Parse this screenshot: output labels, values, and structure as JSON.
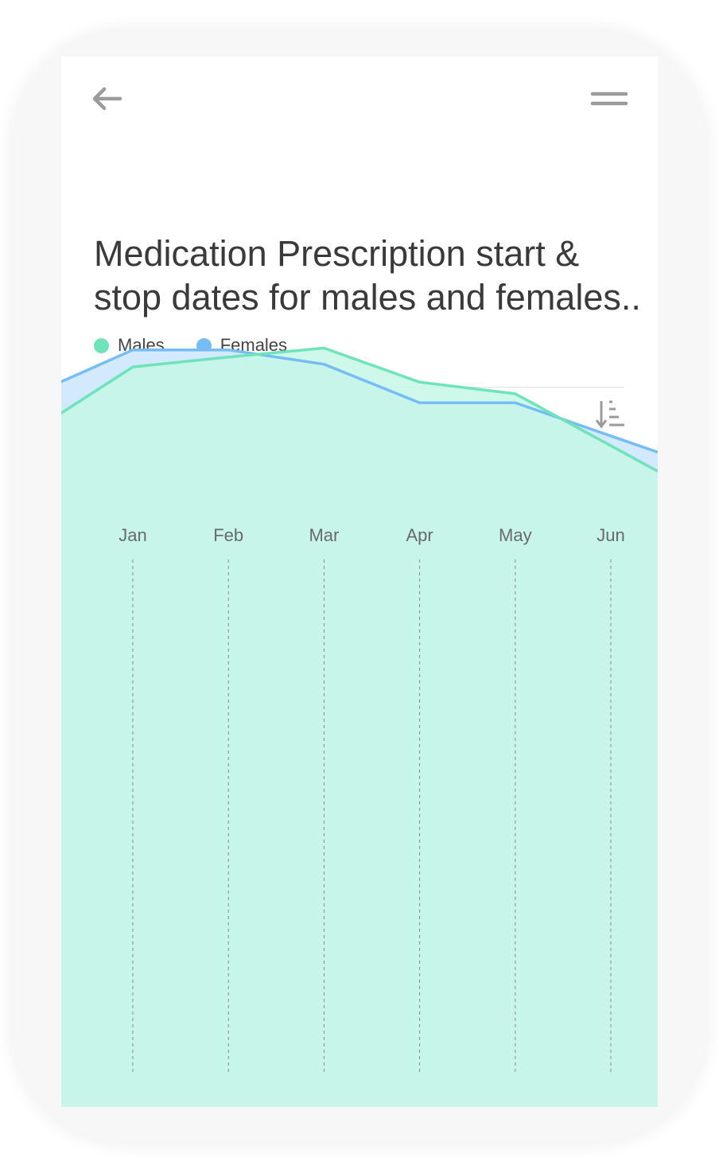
{
  "header": {
    "back_icon": "arrow-left-icon",
    "menu_icon": "hamburger-menu-icon"
  },
  "title": "Medication Prescription start &\nstop dates for males and females..",
  "toolbar": {
    "sort_icon": "sort-descending-icon"
  },
  "colors": {
    "males": "#6fe3b9",
    "females": "#76bdf6",
    "males_fill": "#c4f7e6",
    "females_fill": "#d3e9fd",
    "icon": "#9b9b9b",
    "text": "#3a3a3a"
  },
  "chart_data": {
    "type": "area",
    "categories": [
      "Jan",
      "Feb",
      "Mar",
      "Apr",
      "May",
      "Jun"
    ],
    "legend": "top-left",
    "grid": "vertical dashed",
    "ylim": [
      0,
      100
    ],
    "series": [
      {
        "name": "Males",
        "values": [
          82.5,
          83.6,
          84.6,
          80.8,
          79.5,
          73.7
        ]
      },
      {
        "name": "Females",
        "values": [
          84.4,
          84.4,
          82.8,
          78.5,
          78.5,
          74.8
        ]
      }
    ]
  }
}
